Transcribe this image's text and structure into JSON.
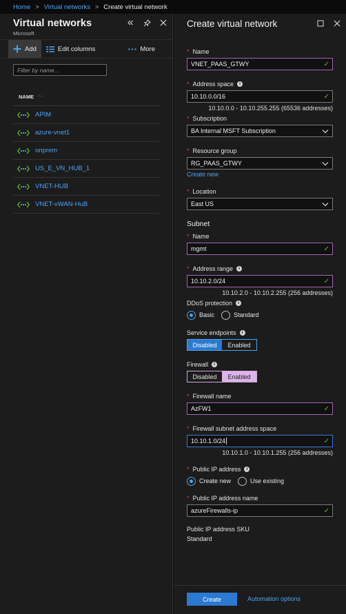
{
  "breadcrumb": {
    "home": "Home",
    "virtual_networks": "Virtual networks",
    "current": "Create virtual network",
    "separator": ">"
  },
  "left": {
    "title": "Virtual networks",
    "subtitle": "Microsoft",
    "toolbar": {
      "add": "Add",
      "edit_columns": "Edit columns",
      "more": "More"
    },
    "filter_placeholder": "Filter by name...",
    "column_header": "NAME",
    "sort_glyph": "↑↓",
    "items": [
      "APIM",
      "azure-vnet1",
      "onprem",
      "US_E_VN_HUB_1",
      "VNET-HUB",
      "VNET-vWAN-HuB"
    ]
  },
  "right": {
    "title": "Create virtual network",
    "required_mark": "*",
    "name": {
      "label": "Name",
      "value": "VNET_PAAS_GTWY"
    },
    "address_space": {
      "label": "Address space",
      "value": "10.10.0.0/16",
      "hint": "10.10.0.0 - 10.10.255.255 (65536 addresses)"
    },
    "subscription": {
      "label": "Subscription",
      "value": "BA Internal MSFT Subscription"
    },
    "resource_group": {
      "label": "Resource group",
      "value": "RG_PAAS_GTWY",
      "create_new": "Create new"
    },
    "location": {
      "label": "Location",
      "value": "East US"
    },
    "subnet": {
      "title": "Subnet",
      "name": {
        "label": "Name",
        "value": "mgmt"
      },
      "address_range": {
        "label": "Address range",
        "value": "10.10.2.0/24",
        "hint": "10.10.2.0 - 10.10.2.255 (256 addresses)"
      }
    },
    "ddos": {
      "label": "DDoS protection",
      "options": [
        "Basic",
        "Standard"
      ],
      "selected": "Basic"
    },
    "service_endpoints": {
      "label": "Service endpoints",
      "options": [
        "Disabled",
        "Enabled"
      ],
      "selected": "Disabled"
    },
    "firewall": {
      "label": "Firewall",
      "options": [
        "Disabled",
        "Enabled"
      ],
      "selected": "Enabled"
    },
    "firewall_name": {
      "label": "Firewall name",
      "value": "AzFW1"
    },
    "firewall_subnet": {
      "label": "Firewall subnet address space",
      "value": "10.10.1.0/24",
      "hint": "10.10.1.0 - 10.10.1.255 (256 addresses)"
    },
    "public_ip": {
      "label": "Public IP address",
      "options": [
        "Create new",
        "Use existing"
      ],
      "selected": "Create new"
    },
    "public_ip_name": {
      "label": "Public IP address name",
      "value": "azureFirewalls-ip"
    },
    "public_ip_sku": {
      "label": "Public IP address SKU",
      "value": "Standard"
    },
    "footer": {
      "create": "Create",
      "automation": "Automation options"
    }
  },
  "colors": {
    "accent": "#2b79d0",
    "link": "#4ea3f0",
    "valid": "#5cb82e",
    "required": "#e83e3e",
    "firewall_selected": "#dcb3ea"
  }
}
